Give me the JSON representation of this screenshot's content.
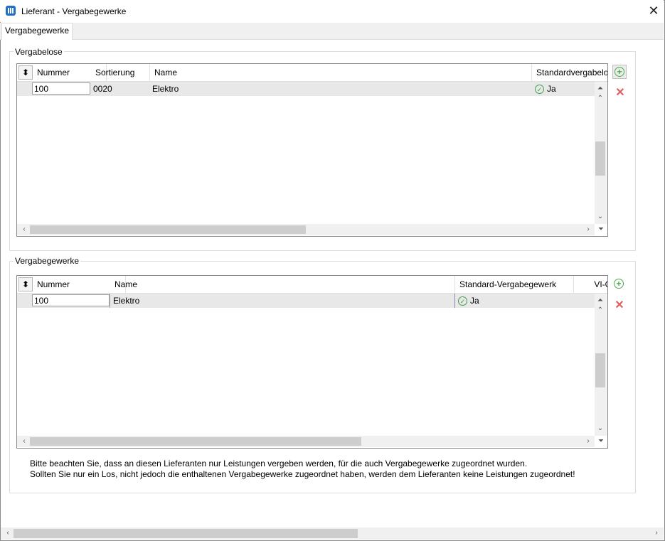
{
  "window": {
    "title": "Lieferant - Vergabegewerke",
    "close_symbol": "✕"
  },
  "tabs": [
    {
      "label": "Vergabegewerke"
    }
  ],
  "vergabelose": {
    "label": "Vergabelose",
    "columns": [
      "Nummer",
      "Sortierung",
      "Name",
      "Standardvergabelo"
    ],
    "rows": [
      {
        "nummer": "100",
        "sortierung": "0020",
        "name": "Elektro",
        "standard": "Ja"
      }
    ]
  },
  "vergabegewerke": {
    "label": "Vergabegewerke",
    "columns": [
      "Nummer",
      "Name",
      "Standard-Vergabegewerk",
      "VI-O"
    ],
    "rows": [
      {
        "nummer": "100",
        "name": "Elektro",
        "standard": "Ja"
      }
    ]
  },
  "notes": [
    "Bitte beachten Sie, dass an diesen Lieferanten nur Leistungen vergeben werden, für die auch Vergabegewerke zugeordnet wurden.",
    "Sollten Sie nur ein Los, nicht jedoch die enthaltenen Vergabegewerke zugeordnet haben, werden dem Lieferanten keine Leistungen zugeordnet!"
  ],
  "icons": {
    "app": "app-icon",
    "sort": "sort-icon",
    "add": "add-icon",
    "delete": "delete-icon",
    "check": "check-icon"
  },
  "colors": {
    "accent": "#1f6fc5",
    "add": "#4caa4c",
    "delete": "#e06060",
    "selected_row": "#e8e8e8"
  }
}
